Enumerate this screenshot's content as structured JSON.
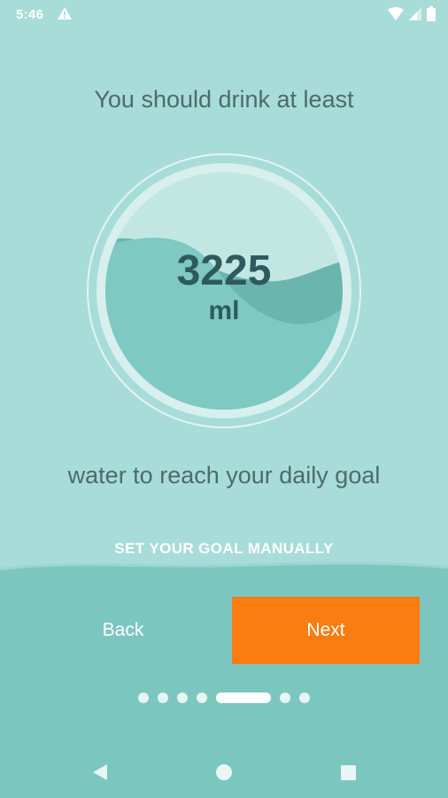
{
  "status_bar": {
    "time": "5:46",
    "icons": [
      "alert-triangle-icon",
      "wifi-icon",
      "cellular-signal-icon",
      "battery-icon"
    ]
  },
  "onboarding": {
    "headline": "You should drink at least",
    "goal_value": "3225",
    "goal_unit": "ml",
    "subline": "water to reach your daily goal",
    "manual_link": "SET YOUR GOAL MANUALLY"
  },
  "actions": {
    "back_label": "Back",
    "next_label": "Next"
  },
  "pager": {
    "total_pages": 7,
    "current_page": 5
  },
  "nav_bar": {
    "icons": [
      "back-triangle-icon",
      "home-circle-icon",
      "recents-square-icon"
    ]
  },
  "colors": {
    "background": "#a8dcd8",
    "panel": "#7cc6c0",
    "accent": "#fb7c10",
    "text_dark": "#4d6b6b",
    "value_text": "#2e5a5e",
    "water_light": "#7ec9c2",
    "water_dark": "#68b4ad"
  }
}
